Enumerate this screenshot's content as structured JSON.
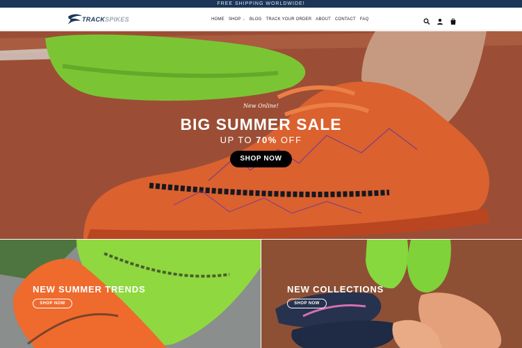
{
  "announcement": "FREE SHIPPING WORLDWIDE!",
  "brand": {
    "part1": "TRACK",
    "part2": "SPIKES"
  },
  "nav": [
    {
      "label": "HOME",
      "dropdown": false
    },
    {
      "label": "SHOP",
      "dropdown": true
    },
    {
      "label": "BLOG",
      "dropdown": false
    },
    {
      "label": "TRACK YOUR ORDER",
      "dropdown": false
    },
    {
      "label": "ABOUT",
      "dropdown": false
    },
    {
      "label": "CONTACT",
      "dropdown": false
    },
    {
      "label": "FAQ",
      "dropdown": false
    }
  ],
  "header_icons": [
    "search-icon",
    "account-icon",
    "cart-icon"
  ],
  "hero": {
    "subtitle": "New Online!",
    "title": "BIG SUMMER SALE",
    "line_prefix": "UP TO ",
    "line_highlight": "70%",
    "line_suffix": " OFF",
    "button": "SHOP NOW"
  },
  "panels": [
    {
      "title": "NEW SUMMER TRENDS",
      "button": "SHOP NOW"
    },
    {
      "title": "NEW COLLECTIONS",
      "button": "SHOP NOW"
    }
  ],
  "colors": {
    "topbar": "#1c3657",
    "hero_button": "#000000",
    "accent_orange": "#e8622e",
    "accent_green": "#7ed321"
  }
}
